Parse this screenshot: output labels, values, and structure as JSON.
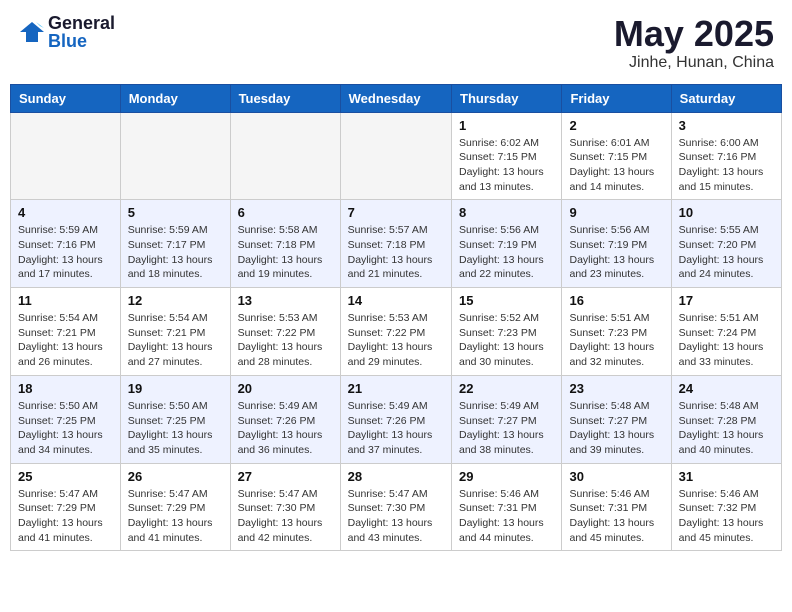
{
  "header": {
    "logo_general": "General",
    "logo_blue": "Blue",
    "month_year": "May 2025",
    "location": "Jinhe, Hunan, China"
  },
  "weekdays": [
    "Sunday",
    "Monday",
    "Tuesday",
    "Wednesday",
    "Thursday",
    "Friday",
    "Saturday"
  ],
  "weeks": [
    [
      {
        "day": "",
        "info": ""
      },
      {
        "day": "",
        "info": ""
      },
      {
        "day": "",
        "info": ""
      },
      {
        "day": "",
        "info": ""
      },
      {
        "day": "1",
        "info": "Sunrise: 6:02 AM\nSunset: 7:15 PM\nDaylight: 13 hours\nand 13 minutes."
      },
      {
        "day": "2",
        "info": "Sunrise: 6:01 AM\nSunset: 7:15 PM\nDaylight: 13 hours\nand 14 minutes."
      },
      {
        "day": "3",
        "info": "Sunrise: 6:00 AM\nSunset: 7:16 PM\nDaylight: 13 hours\nand 15 minutes."
      }
    ],
    [
      {
        "day": "4",
        "info": "Sunrise: 5:59 AM\nSunset: 7:16 PM\nDaylight: 13 hours\nand 17 minutes."
      },
      {
        "day": "5",
        "info": "Sunrise: 5:59 AM\nSunset: 7:17 PM\nDaylight: 13 hours\nand 18 minutes."
      },
      {
        "day": "6",
        "info": "Sunrise: 5:58 AM\nSunset: 7:18 PM\nDaylight: 13 hours\nand 19 minutes."
      },
      {
        "day": "7",
        "info": "Sunrise: 5:57 AM\nSunset: 7:18 PM\nDaylight: 13 hours\nand 21 minutes."
      },
      {
        "day": "8",
        "info": "Sunrise: 5:56 AM\nSunset: 7:19 PM\nDaylight: 13 hours\nand 22 minutes."
      },
      {
        "day": "9",
        "info": "Sunrise: 5:56 AM\nSunset: 7:19 PM\nDaylight: 13 hours\nand 23 minutes."
      },
      {
        "day": "10",
        "info": "Sunrise: 5:55 AM\nSunset: 7:20 PM\nDaylight: 13 hours\nand 24 minutes."
      }
    ],
    [
      {
        "day": "11",
        "info": "Sunrise: 5:54 AM\nSunset: 7:21 PM\nDaylight: 13 hours\nand 26 minutes."
      },
      {
        "day": "12",
        "info": "Sunrise: 5:54 AM\nSunset: 7:21 PM\nDaylight: 13 hours\nand 27 minutes."
      },
      {
        "day": "13",
        "info": "Sunrise: 5:53 AM\nSunset: 7:22 PM\nDaylight: 13 hours\nand 28 minutes."
      },
      {
        "day": "14",
        "info": "Sunrise: 5:53 AM\nSunset: 7:22 PM\nDaylight: 13 hours\nand 29 minutes."
      },
      {
        "day": "15",
        "info": "Sunrise: 5:52 AM\nSunset: 7:23 PM\nDaylight: 13 hours\nand 30 minutes."
      },
      {
        "day": "16",
        "info": "Sunrise: 5:51 AM\nSunset: 7:23 PM\nDaylight: 13 hours\nand 32 minutes."
      },
      {
        "day": "17",
        "info": "Sunrise: 5:51 AM\nSunset: 7:24 PM\nDaylight: 13 hours\nand 33 minutes."
      }
    ],
    [
      {
        "day": "18",
        "info": "Sunrise: 5:50 AM\nSunset: 7:25 PM\nDaylight: 13 hours\nand 34 minutes."
      },
      {
        "day": "19",
        "info": "Sunrise: 5:50 AM\nSunset: 7:25 PM\nDaylight: 13 hours\nand 35 minutes."
      },
      {
        "day": "20",
        "info": "Sunrise: 5:49 AM\nSunset: 7:26 PM\nDaylight: 13 hours\nand 36 minutes."
      },
      {
        "day": "21",
        "info": "Sunrise: 5:49 AM\nSunset: 7:26 PM\nDaylight: 13 hours\nand 37 minutes."
      },
      {
        "day": "22",
        "info": "Sunrise: 5:49 AM\nSunset: 7:27 PM\nDaylight: 13 hours\nand 38 minutes."
      },
      {
        "day": "23",
        "info": "Sunrise: 5:48 AM\nSunset: 7:27 PM\nDaylight: 13 hours\nand 39 minutes."
      },
      {
        "day": "24",
        "info": "Sunrise: 5:48 AM\nSunset: 7:28 PM\nDaylight: 13 hours\nand 40 minutes."
      }
    ],
    [
      {
        "day": "25",
        "info": "Sunrise: 5:47 AM\nSunset: 7:29 PM\nDaylight: 13 hours\nand 41 minutes."
      },
      {
        "day": "26",
        "info": "Sunrise: 5:47 AM\nSunset: 7:29 PM\nDaylight: 13 hours\nand 41 minutes."
      },
      {
        "day": "27",
        "info": "Sunrise: 5:47 AM\nSunset: 7:30 PM\nDaylight: 13 hours\nand 42 minutes."
      },
      {
        "day": "28",
        "info": "Sunrise: 5:47 AM\nSunset: 7:30 PM\nDaylight: 13 hours\nand 43 minutes."
      },
      {
        "day": "29",
        "info": "Sunrise: 5:46 AM\nSunset: 7:31 PM\nDaylight: 13 hours\nand 44 minutes."
      },
      {
        "day": "30",
        "info": "Sunrise: 5:46 AM\nSunset: 7:31 PM\nDaylight: 13 hours\nand 45 minutes."
      },
      {
        "day": "31",
        "info": "Sunrise: 5:46 AM\nSunset: 7:32 PM\nDaylight: 13 hours\nand 45 minutes."
      }
    ]
  ]
}
